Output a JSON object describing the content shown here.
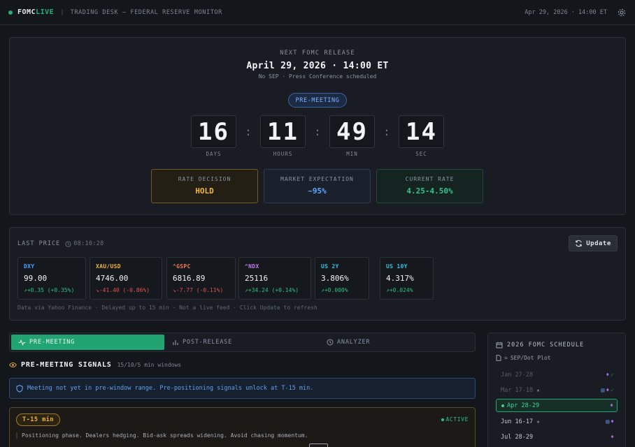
{
  "header": {
    "brand_main": "FOMC",
    "brand_accent": "LIVE",
    "separator": "|",
    "subtitle": "TRADING DESK — FEDERAL RESERVE MONITOR",
    "datetime": "Apr 29, 2026 · 14:00 ET"
  },
  "countdown": {
    "label": "NEXT FOMC RELEASE",
    "date": "April 29, 2026 · 14:00 ET",
    "note": "No SEP · Press Conference scheduled",
    "phase_pill": "PRE-MEETING",
    "units": [
      {
        "value": "16",
        "label": "DAYS"
      },
      {
        "value": "11",
        "label": "HOURS"
      },
      {
        "value": "49",
        "label": "MIN"
      },
      {
        "value": "14",
        "label": "SEC"
      }
    ],
    "colon": ":"
  },
  "stats": {
    "rate_decision": {
      "label": "RATE DECISION",
      "value": "HOLD"
    },
    "market_expectation": {
      "label": "MARKET EXPECTATION",
      "value": "~95%"
    },
    "current_rate": {
      "label": "CURRENT RATE",
      "value": "4.25-4.50%"
    }
  },
  "prices": {
    "label": "LAST PRICE",
    "time": "08:10:28",
    "update_label": "Update",
    "footer": "Data via Yahoo Finance · Delayed up to 15 min · Not a live feed · Click Update to refresh",
    "tickers": [
      {
        "name": "DXY",
        "price": "99.00",
        "change": "+0.35 (+0.35%)",
        "name_color": "#4aa3ff",
        "direction": "up"
      },
      {
        "name": "XAU/USD",
        "price": "4746.00",
        "change": "-41.40 (-0.86%)",
        "name_color": "#f0b53b",
        "direction": "down"
      },
      {
        "name": "^GSPC",
        "price": "6816.89",
        "change": "-7.77 (-0.11%)",
        "name_color": "#f07a5a",
        "direction": "down"
      },
      {
        "name": "^NDX",
        "price": "25116",
        "change": "+34.24 (+0.14%)",
        "name_color": "#c07af0",
        "direction": "up"
      },
      {
        "name": "US 2Y",
        "price": "3.806%",
        "change": "+0.000%",
        "name_color": "#35c2e0",
        "direction": "up"
      },
      {
        "name": "US 10Y",
        "price": "4.317%",
        "change": "+0.024%",
        "name_color": "#35c2e0",
        "direction": "up"
      }
    ]
  },
  "tabs": {
    "pre": "PRE-MEETING",
    "post": "POST-RELEASE",
    "analyzer": "ANALYZER"
  },
  "signals": {
    "title": "PRE-MEETING SIGNALS",
    "windows": "15/10/5 min windows",
    "alert": "Meeting not yet in pre-window range. Pre-positioning signals unlock at T-15 min.",
    "phase_badge": "T-15 min",
    "phase_status": "ACTIVE",
    "phase_desc": "Positioning phase. Dealers hedging. Bid-ask spreads widening. Avoid chasing momentum."
  },
  "schedule": {
    "title": "2026 FOMC SCHEDULE",
    "legend_eq": "=",
    "legend_text": "SEP/Dot Plot",
    "rows": [
      {
        "date": "Jan 27-28",
        "star": "",
        "state": "past",
        "doc": false,
        "mic": true,
        "check": true
      },
      {
        "date": "Mar 17-18",
        "star": "★",
        "state": "past",
        "doc": true,
        "mic": true,
        "check": true
      },
      {
        "date": "Apr 28-29",
        "star": "",
        "state": "current",
        "doc": false,
        "mic": true,
        "check": false
      },
      {
        "date": "Jun 16-17",
        "star": "★",
        "state": "future",
        "doc": true,
        "mic": true,
        "check": false
      },
      {
        "date": "Jul 28-29",
        "star": "",
        "state": "future",
        "doc": false,
        "mic": true,
        "check": false
      }
    ]
  },
  "colors": {
    "accent": "#23b07a",
    "background": "#13161b",
    "hold": "#f0b53b",
    "expectation": "#5fa8ff"
  },
  "icons": [
    "gear-icon",
    "clock-icon",
    "refresh-icon",
    "pulse-icon",
    "bar-chart-icon",
    "analyzer-icon",
    "eye-icon",
    "shield-icon",
    "calendar-icon",
    "document-icon",
    "microphone-icon",
    "check-icon"
  ]
}
